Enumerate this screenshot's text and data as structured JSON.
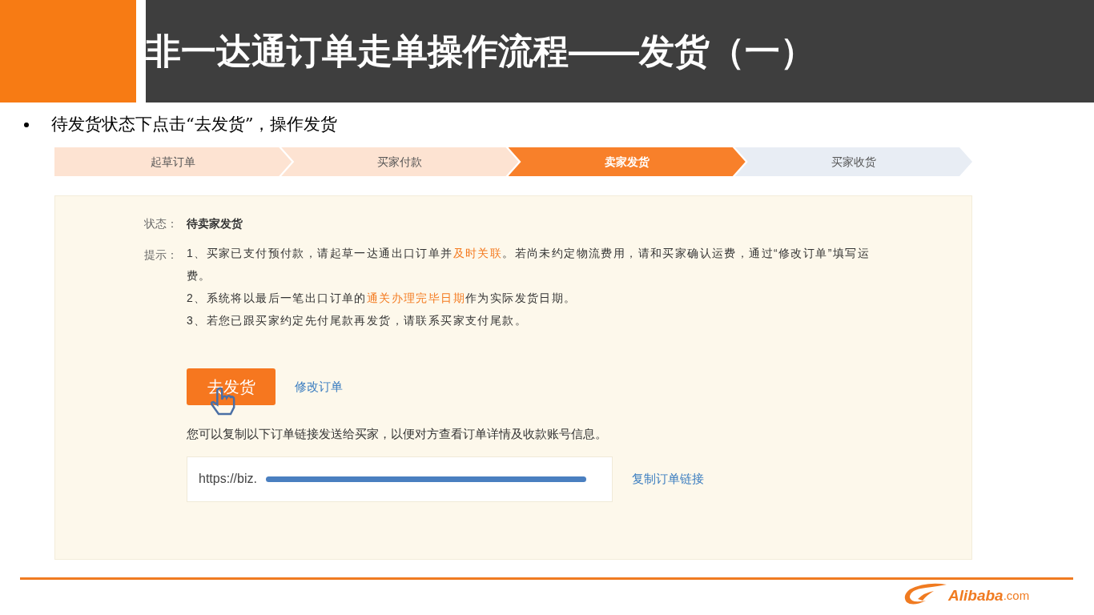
{
  "slide": {
    "title": "非一达通订单走单操作流程——发货（一）",
    "bullet": "待发货状态下点击“去发货”，操作发货"
  },
  "steps": [
    {
      "label": "起草订单",
      "kind": "done",
      "selected": false
    },
    {
      "label": "买家付款",
      "kind": "done",
      "selected": false
    },
    {
      "label": "卖家发货",
      "kind": "current",
      "selected": true
    },
    {
      "label": "买家收货",
      "kind": "todo",
      "selected": false
    }
  ],
  "status": {
    "label": "状态：",
    "value": "待卖家发货"
  },
  "tips": {
    "label": "提示：",
    "lines": [
      [
        {
          "text": "1、买家已支付预付款，请起草一达通出口订单并",
          "highlight": false
        },
        {
          "text": "及时关联",
          "highlight": true
        },
        {
          "text": "。若尚未约定物流费用，请和买家确认运费，通过“修改订单”填写运费。",
          "highlight": false
        }
      ],
      [
        {
          "text": "2、系统将以最后一笔出口订单的",
          "highlight": false
        },
        {
          "text": "通关办理完毕日期",
          "highlight": true
        },
        {
          "text": "作为实际发货日期。",
          "highlight": false
        }
      ],
      [
        {
          "text": "3、若您已跟买家约定先付尾款再发货，请联系买家支付尾款。",
          "highlight": false
        }
      ]
    ]
  },
  "actions": {
    "primary": "去发货",
    "secondary": "修改订单"
  },
  "share": {
    "hint": "您可以复制以下订单链接发送给买家，以便对方查看订单详情及收款账号信息。",
    "url": "https://biz.",
    "copy_link": "复制订单链接"
  },
  "footer": {
    "logo": "Alibaba",
    "logo_suffix": ".com"
  }
}
